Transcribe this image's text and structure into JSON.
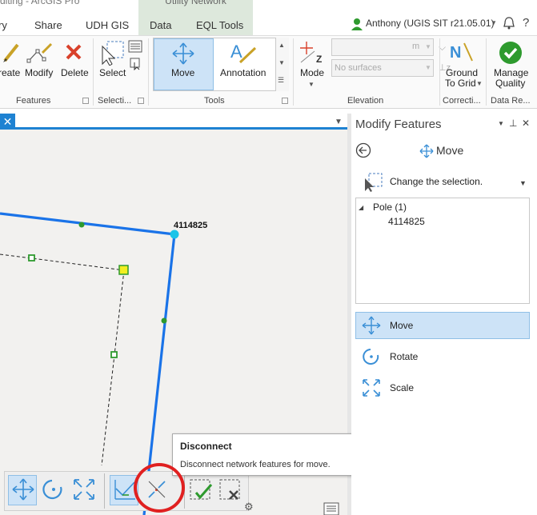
{
  "app": {
    "window_title_fragment": "diting - ArcGIS Pro",
    "contextual_group": "Utility Network",
    "tabs": [
      "ry",
      "Share",
      "UDH GIS",
      "Data",
      "EQL Tools"
    ],
    "user": "Anthony (UGIS SIT r21.05.01)"
  },
  "ribbon": {
    "features": {
      "create": "reate",
      "modify": "Modify",
      "delete": "Delete",
      "group": "Features"
    },
    "selection": {
      "select": "Select",
      "group": "Selecti..."
    },
    "tools": {
      "move": "Move",
      "annotation": "Annotation",
      "group": "Tools"
    },
    "elevation": {
      "mode": "Mode",
      "unit": "m",
      "surfaces_placeholder": "No surfaces",
      "group": "Elevation"
    },
    "corrections": {
      "ground_to_grid_line1": "Ground",
      "ground_to_grid_line2": "To Grid",
      "group": "Correcti..."
    },
    "data_reviewer": {
      "manage_line1": "Manage",
      "manage_line2": "Quality",
      "group": "Data Re..."
    }
  },
  "map": {
    "pole_label": "4114825"
  },
  "tooltip": {
    "title": "Disconnect",
    "description": "Disconnect network features for move."
  },
  "pane": {
    "title": "Modify Features",
    "tool_name": "Move",
    "selection_label": "Change the selection.",
    "tree_group": "Pole (1)",
    "tree_item": "4114825",
    "items": [
      {
        "label": "Move"
      },
      {
        "label": "Rotate"
      },
      {
        "label": "Scale"
      }
    ]
  },
  "colors": {
    "accent": "#1e82d2",
    "selection_bg": "#cde3f7",
    "network_line": "#1a73e8",
    "junction_green": "#2e9a2e",
    "annotation_red": "#e02020"
  }
}
